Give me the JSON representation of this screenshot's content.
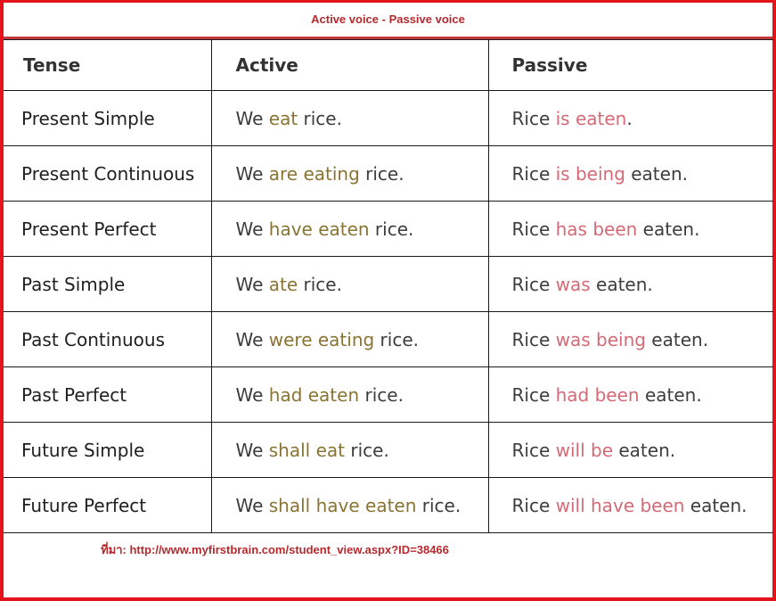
{
  "title": "Active voice - Passive voice",
  "colors": {
    "frame": "#e4141b",
    "title": "#b52a2e",
    "active_highlight": "#8a7433",
    "passive_highlight": "#d46a75",
    "text": "#3d3d3d"
  },
  "table": {
    "headers": [
      "Tense",
      "Active",
      "Passive"
    ],
    "rows": [
      {
        "tense": "Present Simple",
        "active": {
          "pre": "We ",
          "hl": "eat",
          "post": " rice."
        },
        "passive": {
          "pre": "Rice ",
          "hl": "is eaten",
          "post": "."
        }
      },
      {
        "tense": "Present Continuous",
        "active": {
          "pre": "We ",
          "hl": "are eating",
          "post": " rice."
        },
        "passive": {
          "pre": "Rice ",
          "hl": "is being",
          "post": " eaten."
        }
      },
      {
        "tense": "Present Perfect",
        "active": {
          "pre": "We ",
          "hl": "have eaten",
          "post": " rice."
        },
        "passive": {
          "pre": "Rice ",
          "hl": "has been",
          "post": " eaten."
        }
      },
      {
        "tense": "Past Simple",
        "active": {
          "pre": "We ",
          "hl": "ate",
          "post": " rice."
        },
        "passive": {
          "pre": "Rice ",
          "hl": "was",
          "post": " eaten."
        }
      },
      {
        "tense": "Past Continuous",
        "active": {
          "pre": "We ",
          "hl": "were eating",
          "post": " rice."
        },
        "passive": {
          "pre": "Rice ",
          "hl": "was being",
          "post": " eaten."
        }
      },
      {
        "tense": "Past Perfect",
        "active": {
          "pre": "We ",
          "hl": "had eaten",
          "post": " rice."
        },
        "passive": {
          "pre": "Rice ",
          "hl": "had been",
          "post": " eaten."
        }
      },
      {
        "tense": "Future Simple",
        "active": {
          "pre": "We ",
          "hl": "shall eat",
          "post": " rice."
        },
        "passive": {
          "pre": "Rice ",
          "hl": "will be",
          "post": " eaten."
        }
      },
      {
        "tense": "Future Perfect",
        "active": {
          "pre": "We ",
          "hl": "shall have eaten",
          "post": " rice."
        },
        "passive": {
          "pre": "Rice ",
          "hl": "will have been",
          "post": " eaten."
        }
      }
    ]
  },
  "source": "ที่มา: http://www.myfirstbrain.com/student_view.aspx?ID=38466"
}
